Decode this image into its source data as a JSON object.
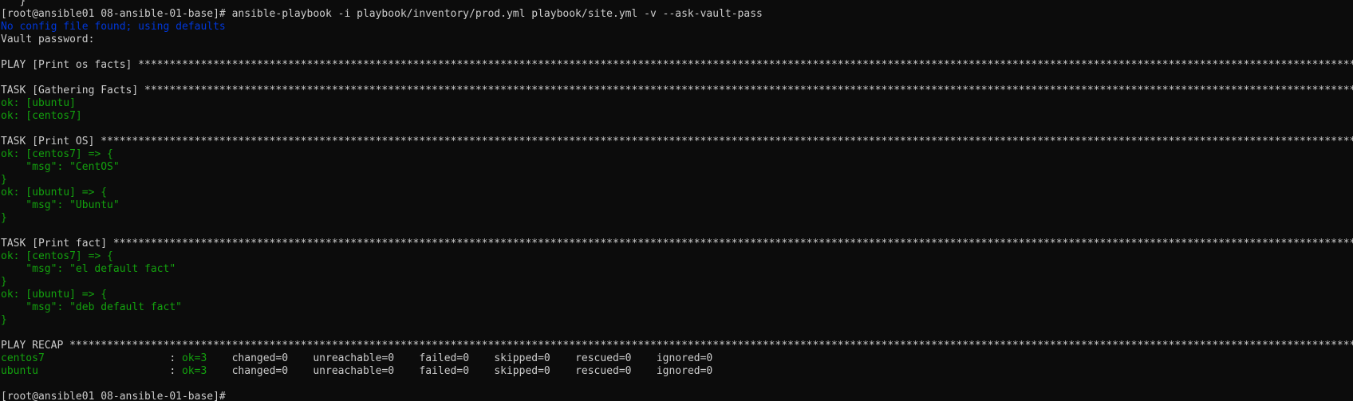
{
  "terminal": {
    "background": "#0c0c0c",
    "palette": {
      "w": "#cccccc",
      "g": "#13a10e",
      "b": "#0037da"
    },
    "lines": [
      {
        "kind": "partial",
        "segments": [
          {
            "c": "w",
            "t": "   }"
          }
        ]
      },
      {
        "kind": "command",
        "segments": [
          {
            "c": "w",
            "t": "[root@ansible01 08-ansible-01-base]# ansible-playbook -i playbook/inventory/prod.yml playbook/site.yml -v --ask-vault-pass"
          }
        ]
      },
      {
        "kind": "info",
        "segments": [
          {
            "c": "b",
            "t": "No config file found; using defaults"
          }
        ]
      },
      {
        "kind": "prompt",
        "segments": [
          {
            "c": "w",
            "t": "Vault password:"
          }
        ]
      },
      {
        "kind": "blank",
        "segments": []
      },
      {
        "kind": "play-header",
        "segments": [
          {
            "c": "w",
            "t": "PLAY [Print os facts] *****************************************************************************************************************************************************************************************************"
          }
        ]
      },
      {
        "kind": "blank",
        "segments": []
      },
      {
        "kind": "task-header",
        "segments": [
          {
            "c": "w",
            "t": "TASK [Gathering Facts] ****************************************************************************************************************************************************************************************************"
          }
        ]
      },
      {
        "kind": "result",
        "segments": [
          {
            "c": "g",
            "t": "ok: [ubuntu]"
          }
        ]
      },
      {
        "kind": "result",
        "segments": [
          {
            "c": "g",
            "t": "ok: [centos7]"
          }
        ]
      },
      {
        "kind": "blank",
        "segments": []
      },
      {
        "kind": "task-header",
        "segments": [
          {
            "c": "w",
            "t": "TASK [Print OS] ***********************************************************************************************************************************************************************************************************"
          }
        ]
      },
      {
        "kind": "result",
        "segments": [
          {
            "c": "g",
            "t": "ok: [centos7] => {"
          }
        ]
      },
      {
        "kind": "result",
        "segments": [
          {
            "c": "g",
            "t": "    \"msg\": \"CentOS\""
          }
        ]
      },
      {
        "kind": "result",
        "segments": [
          {
            "c": "g",
            "t": "}"
          }
        ]
      },
      {
        "kind": "result",
        "segments": [
          {
            "c": "g",
            "t": "ok: [ubuntu] => {"
          }
        ]
      },
      {
        "kind": "result",
        "segments": [
          {
            "c": "g",
            "t": "    \"msg\": \"Ubuntu\""
          }
        ]
      },
      {
        "kind": "result",
        "segments": [
          {
            "c": "g",
            "t": "}"
          }
        ]
      },
      {
        "kind": "blank",
        "segments": []
      },
      {
        "kind": "task-header",
        "segments": [
          {
            "c": "w",
            "t": "TASK [Print fact] *********************************************************************************************************************************************************************************************************"
          }
        ]
      },
      {
        "kind": "result",
        "segments": [
          {
            "c": "g",
            "t": "ok: [centos7] => {"
          }
        ]
      },
      {
        "kind": "result",
        "segments": [
          {
            "c": "g",
            "t": "    \"msg\": \"el default fact\""
          }
        ]
      },
      {
        "kind": "result",
        "segments": [
          {
            "c": "g",
            "t": "}"
          }
        ]
      },
      {
        "kind": "result",
        "segments": [
          {
            "c": "g",
            "t": "ok: [ubuntu] => {"
          }
        ]
      },
      {
        "kind": "result",
        "segments": [
          {
            "c": "g",
            "t": "    \"msg\": \"deb default fact\""
          }
        ]
      },
      {
        "kind": "result",
        "segments": [
          {
            "c": "g",
            "t": "}"
          }
        ]
      },
      {
        "kind": "blank",
        "segments": []
      },
      {
        "kind": "recap-header",
        "segments": [
          {
            "c": "w",
            "t": "PLAY RECAP ****************************************************************************************************************************************************************************************************************"
          }
        ]
      },
      {
        "kind": "recap-row",
        "segments": [
          {
            "c": "g",
            "t": "centos7"
          },
          {
            "c": "w",
            "t": "                    : "
          },
          {
            "c": "g",
            "t": "ok=3"
          },
          {
            "c": "w",
            "t": "    changed=0    unreachable=0    failed=0    skipped=0    rescued=0    ignored=0"
          }
        ]
      },
      {
        "kind": "recap-row",
        "segments": [
          {
            "c": "g",
            "t": "ubuntu"
          },
          {
            "c": "w",
            "t": "                     : "
          },
          {
            "c": "g",
            "t": "ok=3"
          },
          {
            "c": "w",
            "t": "    changed=0    unreachable=0    failed=0    skipped=0    rescued=0    ignored=0"
          }
        ]
      },
      {
        "kind": "blank",
        "segments": []
      },
      {
        "kind": "prompt-current",
        "segments": [
          {
            "c": "w",
            "t": "[root@ansible01 08-ansible-01-base]# "
          }
        ]
      }
    ]
  }
}
